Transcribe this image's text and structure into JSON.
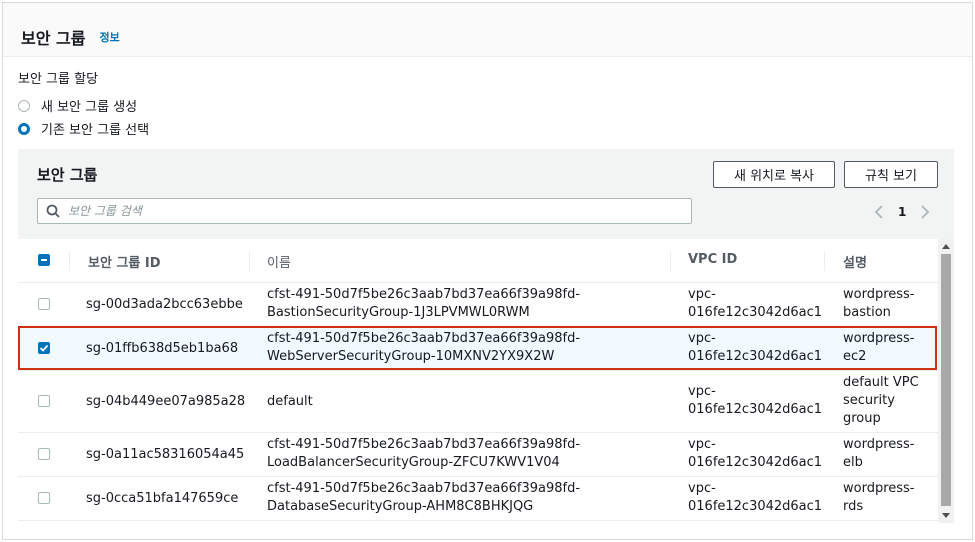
{
  "header": {
    "title": "보안 그룹",
    "info_link": "정보"
  },
  "assignment": {
    "label": "보안 그룹 할당",
    "options": [
      {
        "label": "새 보안 그룹 생성",
        "selected": false
      },
      {
        "label": "기존 보안 그룹 선택",
        "selected": true
      }
    ]
  },
  "panel": {
    "title": "보안 그룹",
    "copy_button": "새 위치로 복사",
    "rules_button": "규칙 보기",
    "search_placeholder": "보안 그룹 검색",
    "page": "1"
  },
  "table": {
    "headers": {
      "id": "보안 그룹 ID",
      "name": "이름",
      "vpc": "VPC ID",
      "desc": "설명"
    },
    "rows": [
      {
        "id": "sg-00d3ada2bcc63ebbe",
        "name1": "cfst-491-50d7f5be26c3aab7bd37ea66f39a98fd-",
        "name2": "BastionSecurityGroup-1J3LPVMWL0RWM",
        "vpc1": "vpc-",
        "vpc2": "016fe12c3042d6ac1",
        "desc1": "wordpress-",
        "desc2": "bastion",
        "desc3": "",
        "checked": false
      },
      {
        "id": "sg-01ffb638d5eb1ba68",
        "name1": "cfst-491-50d7f5be26c3aab7bd37ea66f39a98fd-",
        "name2": "WebServerSecurityGroup-10MXNV2YX9X2W",
        "vpc1": "vpc-",
        "vpc2": "016fe12c3042d6ac1",
        "desc1": "wordpress-",
        "desc2": "ec2",
        "desc3": "",
        "checked": true
      },
      {
        "id": "sg-04b449ee07a985a28",
        "name1": "default",
        "name2": "",
        "vpc1": "vpc-",
        "vpc2": "016fe12c3042d6ac1",
        "desc1": "default VPC",
        "desc2": "security",
        "desc3": "group",
        "checked": false
      },
      {
        "id": "sg-0a11ac58316054a45",
        "name1": "cfst-491-50d7f5be26c3aab7bd37ea66f39a98fd-",
        "name2": "LoadBalancerSecurityGroup-ZFCU7KWV1V04",
        "vpc1": "vpc-",
        "vpc2": "016fe12c3042d6ac1",
        "desc1": "wordpress-",
        "desc2": "elb",
        "desc3": "",
        "checked": false
      },
      {
        "id": "sg-0cca51bfa147659ce",
        "name1": "cfst-491-50d7f5be26c3aab7bd37ea66f39a98fd-",
        "name2": "DatabaseSecurityGroup-AHM8C8BHKJQG",
        "vpc1": "vpc-",
        "vpc2": "016fe12c3042d6ac1",
        "desc1": "wordpress-",
        "desc2": "rds",
        "desc3": "",
        "checked": false
      }
    ]
  },
  "colors": {
    "accent": "#0073bb",
    "selection_outline": "#d13212",
    "selected_row": "#f1faff"
  }
}
